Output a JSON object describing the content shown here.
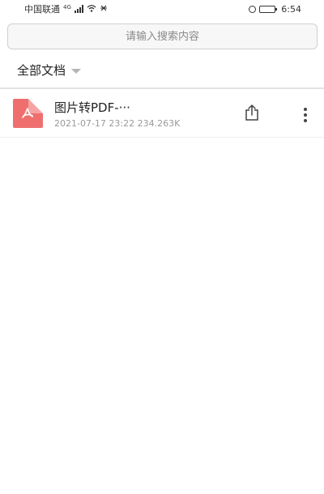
{
  "status_bar": {
    "carrier": "中国联通",
    "network_badge": "4G",
    "time": "6:54",
    "icons": [
      "signal-icon",
      "wifi-icon",
      "data-icon",
      "alarm-icon",
      "battery-icon"
    ]
  },
  "search": {
    "placeholder": "请输入搜索内容",
    "value": ""
  },
  "filter": {
    "label": "全部文档",
    "icon": "chevron-down-icon"
  },
  "files": [
    {
      "name": "图片转PDF-···",
      "date": "2021-07-17 23:22",
      "size": "234.263K",
      "meta": "2021-07-17 23:22 234.263K",
      "icon": "pdf-file-icon",
      "actions": [
        "share-icon",
        "more-icon"
      ]
    }
  ],
  "colors": {
    "pdf_icon": "#ef6f6f",
    "meta_text": "#9a9a9a",
    "search_border": "#d0d0d0"
  }
}
